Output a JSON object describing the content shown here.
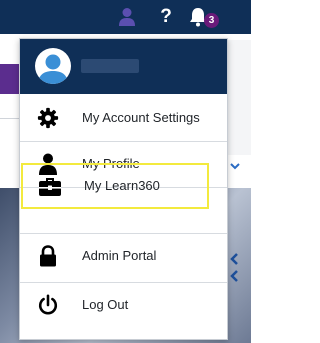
{
  "nav": {
    "icons": [
      "user-icon",
      "help-icon",
      "bell-icon"
    ],
    "help_glyph": "?",
    "notification_count": "3"
  },
  "menu": {
    "username": "",
    "items": [
      {
        "label": "My Account Settings",
        "icon": "gear-icon"
      },
      {
        "label": "My Profile",
        "icon": "person-icon"
      },
      {
        "label": "My Learn360",
        "icon": "briefcase-icon",
        "highlighted": true
      },
      {
        "label": "Admin Portal",
        "icon": "lock-icon"
      },
      {
        "label": "Log Out",
        "icon": "power-icon"
      }
    ]
  },
  "colors": {
    "nav_background": "#0f2f57",
    "user_icon": "#5b4fb0",
    "badge": "#6a1a7a",
    "highlight_border": "#f3ea3d",
    "background_accent": "#5b2d8e"
  }
}
